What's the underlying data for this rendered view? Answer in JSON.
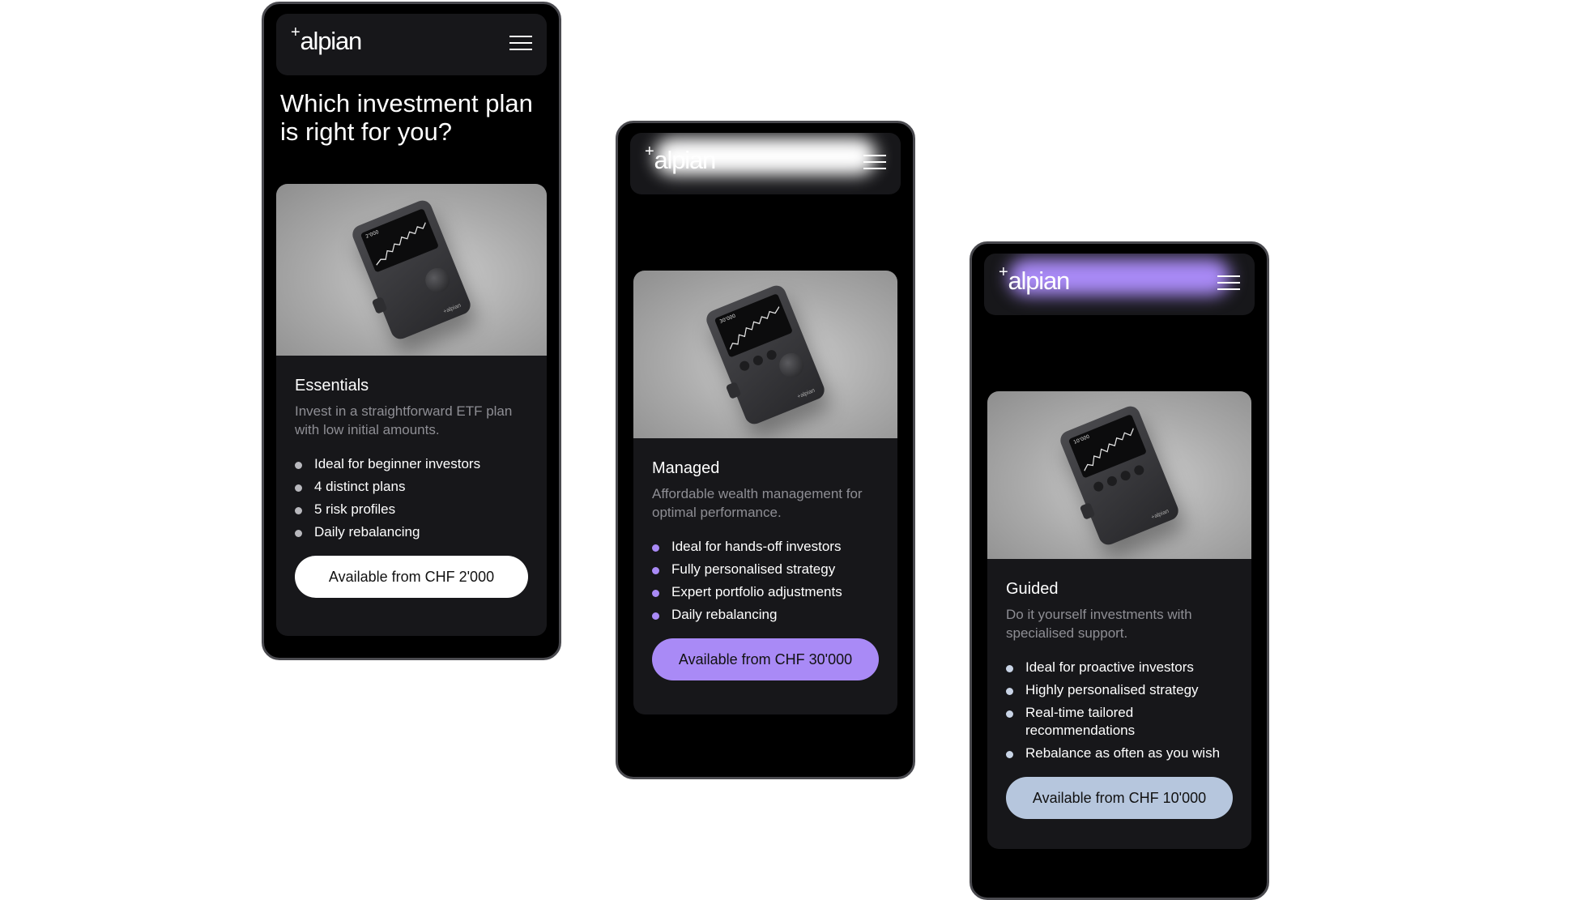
{
  "brand": {
    "logo_plus": "+",
    "logo_text": "alpian"
  },
  "headline": "Which investment plan is right for you?",
  "plans": [
    {
      "name": "Essentials",
      "description": "Invest in a straightforward ETF plan with low initial amounts.",
      "features": [
        "Ideal for beginner investors",
        "4 distinct plans",
        "5 risk profiles",
        "Daily rebalancing"
      ],
      "cta": "Available from CHF 2'000",
      "device_amount": "2'000",
      "accent": "#ffffff"
    },
    {
      "name": "Managed",
      "description": "Affordable wealth management for optimal performance.",
      "features": [
        "Ideal for hands-off investors",
        "Fully personalised strategy",
        "Expert portfolio adjustments",
        "Daily rebalancing"
      ],
      "cta": "Available from CHF 30'000",
      "device_amount": "30'000",
      "accent": "#a98af6"
    },
    {
      "name": "Guided",
      "description": "Do it yourself investments with specialised support.",
      "features": [
        "Ideal for proactive investors",
        "Highly personalised strategy",
        "Real-time tailored recommendations",
        "Rebalance as often as you wish"
      ],
      "cta": "Available from CHF 10'000",
      "device_amount": "10'000",
      "accent": "#b6c6dd"
    }
  ],
  "colors": {
    "background": "#ffffff",
    "phone_bg": "#000000",
    "card_bg": "#17171a",
    "muted_text": "#8e8e94"
  },
  "icons": {
    "menu": "hamburger-menu-icon",
    "bullet": "bullet-dot-icon"
  }
}
